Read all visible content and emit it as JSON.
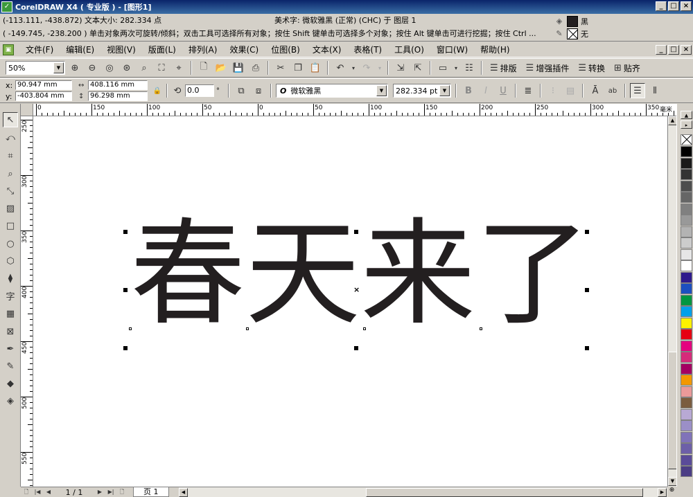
{
  "titlebar": {
    "title": "CorelDRAW X4 ( 专业版 ) - [图形1]",
    "minimize": "_",
    "restore": "□",
    "close": "×"
  },
  "status": {
    "row1": "(-113.111, -438.872)  文本大小: 282.334 点",
    "row1_center": "美术字: 微软雅黑 (正常) (CHC) 于 图层 1",
    "row2": "( -149.745, -238.200 )  单击对象两次可旋转/倾斜；双击工具可选择所有对象；按住 Shift 键单击可选择多个对象；按住 Alt 键单击可进行挖掘；按住 Ctrl ...",
    "fill_label": "黑",
    "outline_label": "无"
  },
  "menu": {
    "items": [
      "文件(F)",
      "编辑(E)",
      "视图(V)",
      "版面(L)",
      "排列(A)",
      "效果(C)",
      "位图(B)",
      "文本(X)",
      "表格(T)",
      "工具(O)",
      "窗口(W)",
      "帮助(H)"
    ]
  },
  "standard_toolbar": {
    "zoom_value": "50%",
    "btn_layout": "排版",
    "btn_plugins": "增强插件",
    "btn_convert": "转换",
    "btn_align": "贴齐"
  },
  "property_bar": {
    "x_label": "x:",
    "y_label": "y:",
    "x_value": "90.947 mm",
    "y_value": "-403.804 mm",
    "width_value": "408.116 mm",
    "height_value": "96.298 mm",
    "rotation_value": "0.0",
    "degree": "°",
    "font_name": "微软雅黑",
    "font_icon": "O",
    "font_size": "282.334 pt",
    "bold": "B",
    "italic": "I",
    "underline": "U"
  },
  "ruler": {
    "unit": "毫米",
    "h_labels": [
      "0",
      "150",
      "100",
      "50",
      "0",
      "50",
      "100",
      "150",
      "200",
      "250",
      "300",
      "350"
    ],
    "v_labels": [
      "250",
      "300",
      "350",
      "400",
      "450",
      "500",
      "550"
    ]
  },
  "canvas": {
    "art_text": "春天来了"
  },
  "pagenav": {
    "page_count": "1 / 1",
    "page_tab": "页 1"
  },
  "palette": {
    "colors": [
      "#000000",
      "#1a1a1a",
      "#333333",
      "#4d4d4d",
      "#666666",
      "#808080",
      "#999999",
      "#b3b3b3",
      "#cccccc",
      "#e6e6e6",
      "#ffffff",
      "#2e1a8c",
      "#1c4fbf",
      "#009640",
      "#00a0e9",
      "#fff100",
      "#e60012",
      "#e4007f",
      "#d62b7a",
      "#a40062",
      "#f39800",
      "#ea9a9a",
      "#7a5c3e",
      "#b8a9d4",
      "#9b8fc7",
      "#8073b9",
      "#6d5fa8",
      "#5a4b99",
      "#4b3d85"
    ]
  }
}
